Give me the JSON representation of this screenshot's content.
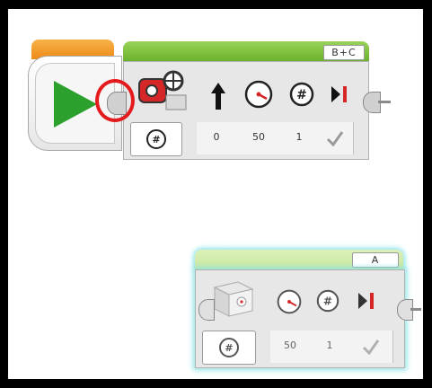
{
  "canvas": {
    "start_block": {
      "name": "start"
    },
    "steering_block": {
      "ports": "B+C",
      "params": [
        "0",
        "50",
        "1"
      ]
    },
    "medium_motor_block": {
      "port": "A",
      "params": [
        "50",
        "1"
      ]
    }
  },
  "icons": {
    "play": "play-icon",
    "steering": "steering-motor-icon",
    "arrow": "up-arrow-icon",
    "speed": "speedometer-icon",
    "rotations": "rotations-icon",
    "brake": "brake-icon",
    "mode": "mode-icon",
    "check": "check-icon"
  },
  "colors": {
    "start_tab": "#ee8b19",
    "steering_bar": "#6bb22c",
    "motor_bar": "#cdeaa1",
    "highlight": "#e41a1c",
    "glow": "#8fe3e6"
  }
}
